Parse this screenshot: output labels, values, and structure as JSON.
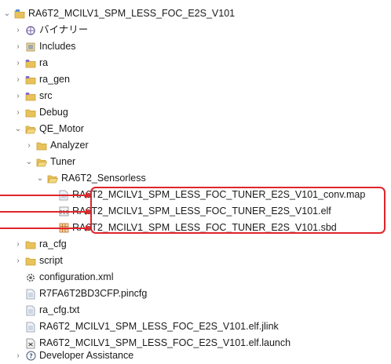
{
  "project": {
    "name": "RA6T2_MCILV1_SPM_LESS_FOC_E2S_V101"
  },
  "items": {
    "binaries": "バイナリー",
    "includes": "Includes",
    "ra": "ra",
    "ra_gen": "ra_gen",
    "src": "src",
    "debug": "Debug",
    "qe_motor": "QE_Motor",
    "analyzer": "Analyzer",
    "tuner": "Tuner",
    "sensorless": "RA6T2_Sensorless",
    "file_map": "RA6T2_MCILV1_SPM_LESS_FOC_TUNER_E2S_V101_conv.map",
    "file_elf": "RA6T2_MCILV1_SPM_LESS_FOC_TUNER_E2S_V101.elf",
    "file_sbd": "RA6T2_MCILV1_SPM_LESS_FOC_TUNER_E2S_V101.sbd",
    "ra_cfg": "ra_cfg",
    "script": "script",
    "configuration": "configuration.xml",
    "pincfg": "R7FA6T2BD3CFP.pincfg",
    "ra_cfg_txt": "ra_cfg.txt",
    "jlink": "RA6T2_MCILV1_SPM_LESS_FOC_E2S_V101.elf.jlink",
    "launch": "RA6T2_MCILV1_SPM_LESS_FOC_E2S_V101.elf.launch",
    "dev_assist": "Developer Assistance"
  },
  "icons": {
    "project": "project-folder-icon",
    "binaries": "binaries-icon",
    "includes": "includes-icon",
    "folder": "folder-icon",
    "file": "file-icon",
    "elf": "elf-binary-icon",
    "sbd": "sbd-file-icon",
    "config": "config-gear-icon",
    "launch": "launch-config-icon",
    "help": "help-icon"
  },
  "colors": {
    "highlight": "#e0252b",
    "folder": "#e8c25a",
    "folder_dark": "#c9a13a"
  }
}
